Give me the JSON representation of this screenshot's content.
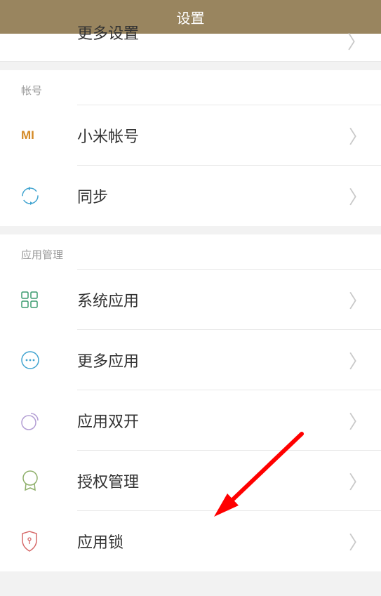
{
  "header": {
    "title": "设置"
  },
  "partial": {
    "label": "更多设置"
  },
  "section_account": {
    "title": "帐号",
    "items": [
      {
        "icon": "mi",
        "label": "小米帐号"
      },
      {
        "icon": "sync",
        "label": "同步"
      }
    ]
  },
  "section_apps": {
    "title": "应用管理",
    "items": [
      {
        "icon": "grid",
        "label": "系统应用"
      },
      {
        "icon": "dots",
        "label": "更多应用"
      },
      {
        "icon": "circles",
        "label": "应用双开"
      },
      {
        "icon": "badge",
        "label": "授权管理"
      },
      {
        "icon": "lock",
        "label": "应用锁"
      }
    ]
  },
  "icons": {
    "chevron": "〉"
  },
  "colors": {
    "header_bg": "#99855f",
    "arrow": "#ff0000",
    "mi": "#d48a26",
    "sync": "#41a4d0",
    "grid": "#3b9b6f",
    "dots": "#41a4d0",
    "circles": "#b39ed4",
    "badge": "#8fb06b",
    "lock": "#d66a6a"
  }
}
